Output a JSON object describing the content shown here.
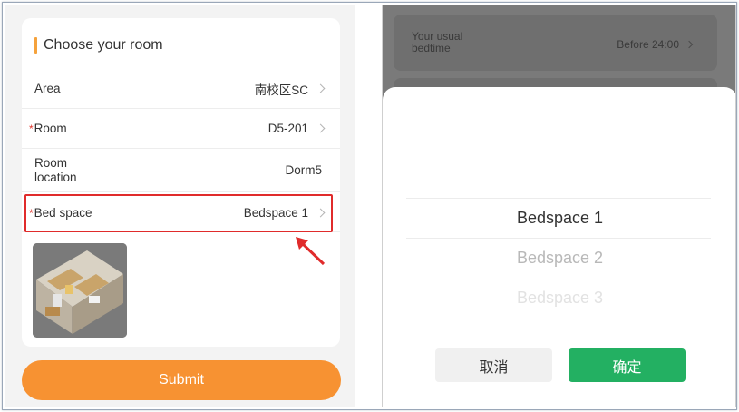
{
  "left": {
    "card_title": "Choose your room",
    "rows": [
      {
        "label": "Area",
        "value": "南校区SC",
        "required": false
      },
      {
        "label": "Room",
        "value": "D5-201",
        "required": true
      },
      {
        "label": "Room location",
        "value": "Dorm5",
        "required": false
      },
      {
        "label": "Bed space",
        "value": "Bedspace 1",
        "required": true
      }
    ],
    "required_mark": "*",
    "submit_label": "Submit"
  },
  "right": {
    "bedtime_label": "Your usual bedtime",
    "bedtime_value": "Before 24:00",
    "options": [
      "Bedspace 1",
      "Bedspace 2",
      "Bedspace 3"
    ],
    "selected_option": "Bedspace 1",
    "cancel_label": "取消",
    "confirm_label": "确定"
  },
  "colors": {
    "accent_orange": "#f79232",
    "highlight_red": "#e02b2b",
    "confirm_green": "#23b062",
    "required_red": "#e0352b"
  },
  "icons": [
    "chevron-right-icon",
    "red-arrow-annotation"
  ]
}
